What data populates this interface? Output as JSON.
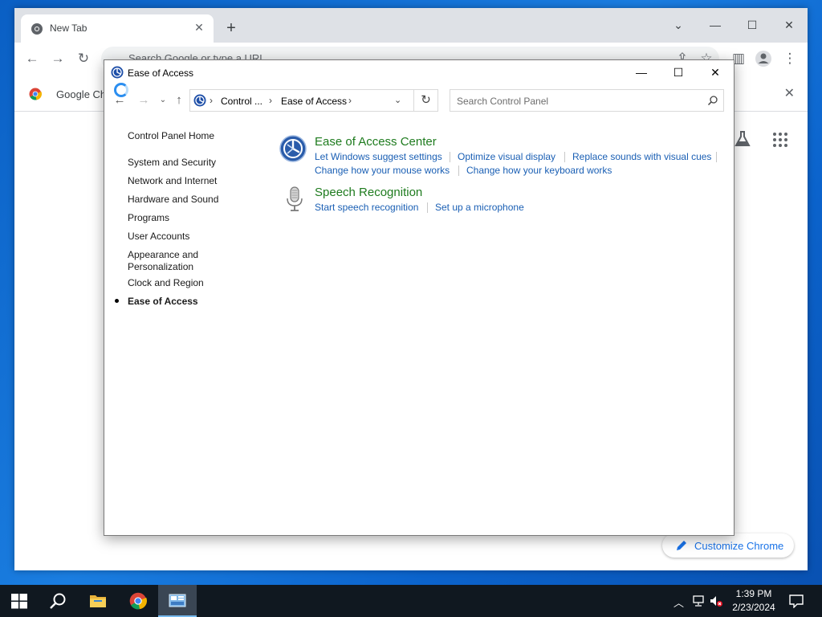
{
  "chrome": {
    "tab_title": "New Tab",
    "omnibox_placeholder": "Search Google or type a URL",
    "bookmark_banner": "Google Chrome",
    "customize_label": "Customize Chrome"
  },
  "control_panel": {
    "title": "Ease of Access",
    "breadcrumb": [
      "Control ...",
      "Ease of Access"
    ],
    "search_placeholder": "Search Control Panel",
    "sidebar": [
      {
        "label": "Control Panel Home"
      },
      {
        "label": "System and Security"
      },
      {
        "label": "Network and Internet"
      },
      {
        "label": "Hardware and Sound"
      },
      {
        "label": "Programs"
      },
      {
        "label": "User Accounts"
      },
      {
        "label": "Appearance and Personalization"
      },
      {
        "label": "Clock and Region"
      },
      {
        "label": "Ease of Access",
        "active": true
      }
    ],
    "categories": [
      {
        "title": "Ease of Access Center",
        "icon": "ease-of-access-icon",
        "links": [
          "Let Windows suggest settings",
          "Optimize visual display",
          "Replace sounds with visual cues",
          "Change how your mouse works",
          "Change how your keyboard works"
        ]
      },
      {
        "title": "Speech Recognition",
        "icon": "microphone-icon",
        "links": [
          "Start speech recognition",
          "Set up a microphone"
        ]
      }
    ]
  },
  "taskbar": {
    "time": "1:39 PM",
    "date": "2/23/2024"
  },
  "colors": {
    "desktop": "#0b63cc",
    "category_title": "#1e7b1e",
    "link": "#1a5fb4",
    "chrome_accent": "#1a73e8",
    "taskbar": "#101820"
  }
}
